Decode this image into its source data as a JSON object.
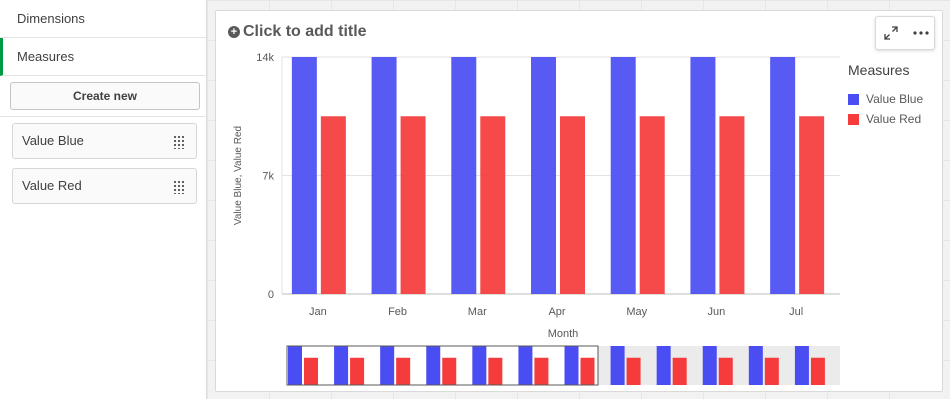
{
  "panel": {
    "nav": [
      {
        "label": "Dimensions"
      },
      {
        "label": "Measures"
      }
    ],
    "create_new_label": "Create new",
    "measures": [
      {
        "label": "Value Blue"
      },
      {
        "label": "Value Red"
      }
    ]
  },
  "chart_header": {
    "title": "Click to add title",
    "expand_icon": "expand-icon",
    "more_icon": "more-icon"
  },
  "legend": {
    "title": "Measures",
    "items": [
      {
        "label": "Value Blue",
        "color": "#4a4df2"
      },
      {
        "label": "Value Red",
        "color": "#f53b3b"
      }
    ]
  },
  "chart_data": {
    "type": "bar",
    "categories": [
      "Jan",
      "Feb",
      "Mar",
      "Apr",
      "May",
      "Jun",
      "Jul"
    ],
    "series": [
      {
        "name": "Value Blue",
        "values": [
          14000,
          14000,
          14000,
          14000,
          14000,
          14000,
          14000
        ],
        "color": "#4a4df2"
      },
      {
        "name": "Value Red",
        "values": [
          10500,
          10500,
          10500,
          10500,
          10500,
          10500,
          10500
        ],
        "color": "#f53b3b"
      }
    ],
    "xlabel": "Month",
    "ylabel": "Value Blue, Value Red",
    "ylim": [
      0,
      14000
    ],
    "yticks": [
      {
        "value": 0,
        "label": "0"
      },
      {
        "value": 7000,
        "label": "7k"
      },
      {
        "value": 14000,
        "label": "14k"
      }
    ],
    "mini_chart_categories": 12
  }
}
